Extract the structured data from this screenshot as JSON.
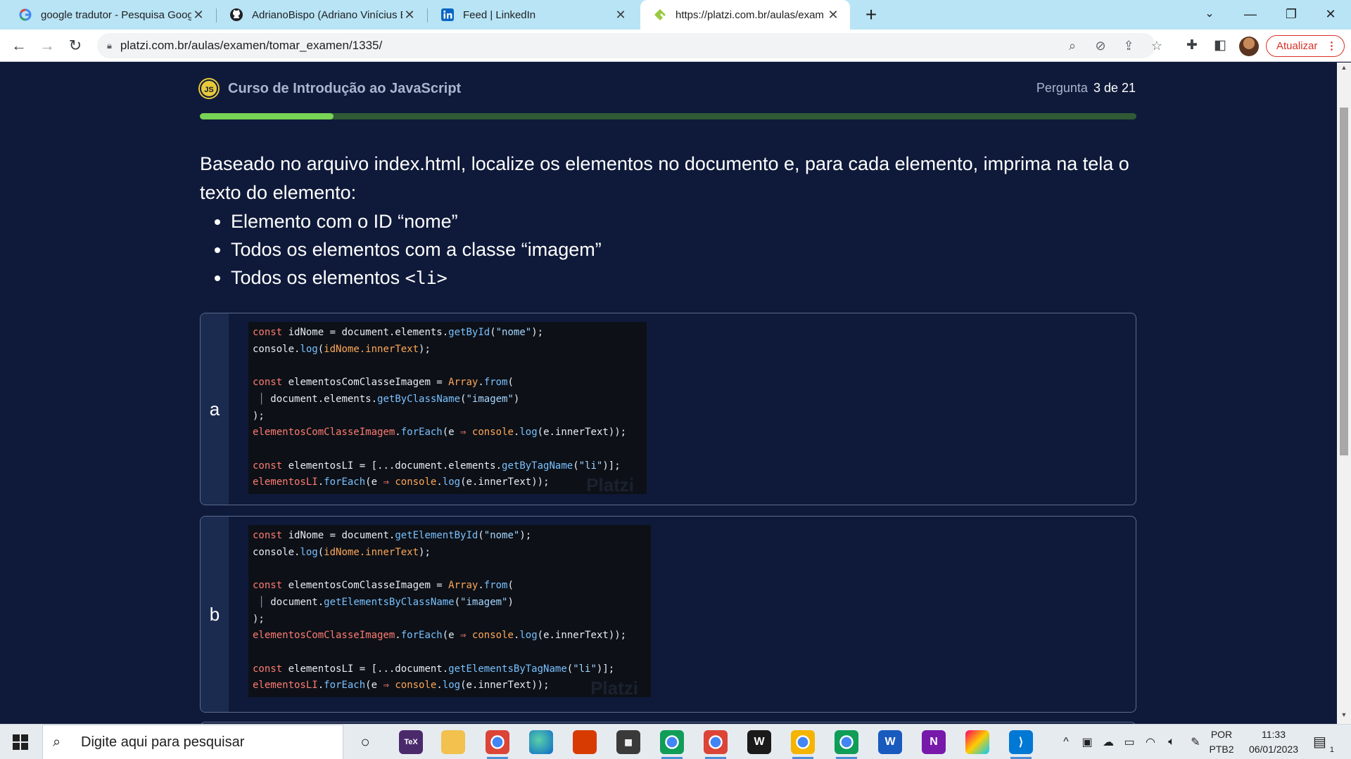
{
  "browser": {
    "tabs": [
      {
        "title": "google tradutor - Pesquisa Goog",
        "icon": "google-icon"
      },
      {
        "title": "AdrianoBispo (Adriano Vinícius B",
        "icon": "github-icon"
      },
      {
        "title": "Feed | LinkedIn",
        "icon": "linkedin-icon"
      },
      {
        "title": "https://platzi.com.br/aulas/exam",
        "icon": "platzi-icon"
      }
    ],
    "new_tab_label": "+",
    "url": "platzi.com.br/aulas/examen/tomar_examen/1335/",
    "update_label": "Atualizar"
  },
  "quiz": {
    "badge": "JS",
    "course_title": "Curso de Introdução ao JavaScript",
    "question_label": "Pergunta",
    "question_value": "3 de 21",
    "progress": 0.143,
    "question_text": "Baseado no arquivo index.html, localize os elementos no documento e, para cada elemento, imprima na tela o texto do elemento:",
    "bullets": [
      "Elemento com o ID “nome”",
      "Todos os elementos com a classe “imagem”",
      "Todos os elementos "
    ],
    "bullet_code": "<li>",
    "options": [
      {
        "letter": "a"
      },
      {
        "letter": "b"
      }
    ],
    "watermark": "Platzi"
  },
  "taskbar": {
    "search_placeholder": "Digite aqui para pesquisar",
    "lang_line1": "POR",
    "lang_line2": "PTB2",
    "time": "11:33",
    "date": "06/01/2023",
    "notifications": "1"
  },
  "colors": {
    "page_bg": "#0f1a3a",
    "progress_fill": "#77d354",
    "progress_track": "#2f5a35",
    "update_red": "#d93025"
  }
}
